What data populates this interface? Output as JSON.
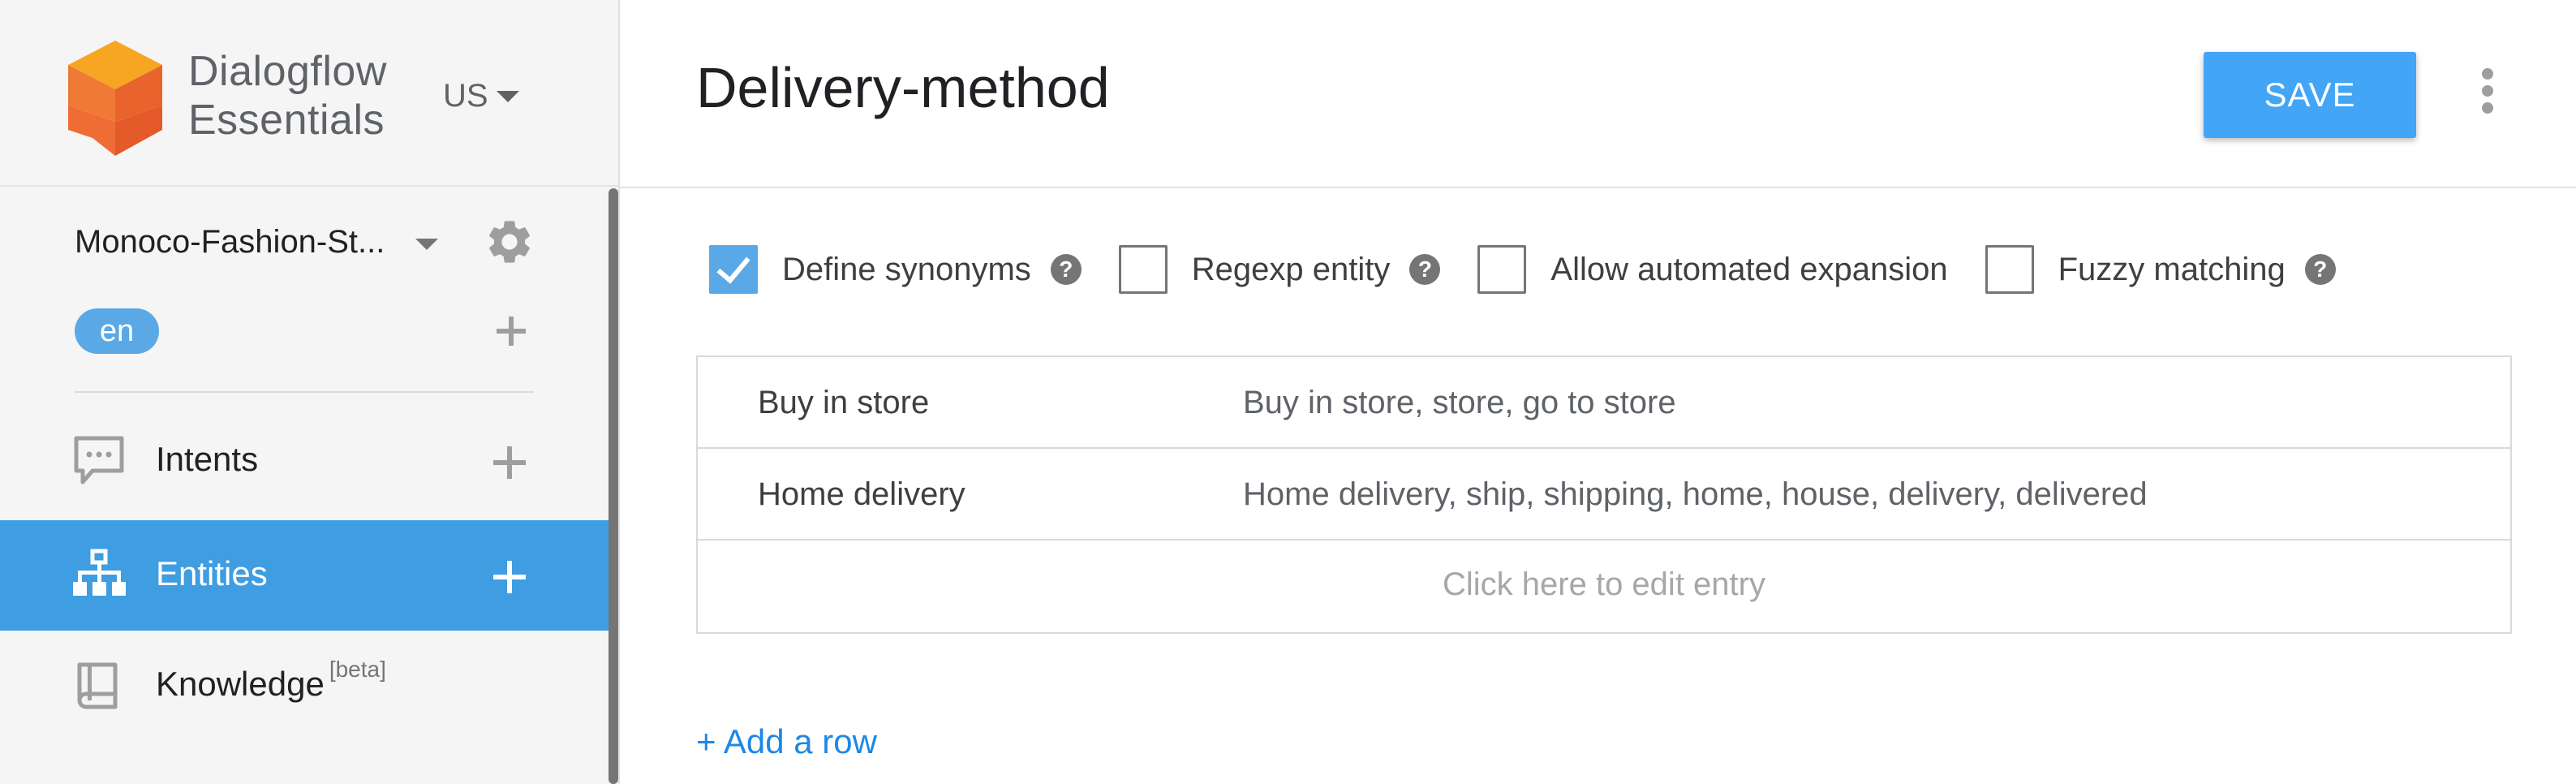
{
  "brand": {
    "line1": "Dialogflow",
    "line2": "Essentials",
    "region": "US"
  },
  "agent": {
    "name": "Monoco-Fashion-St...",
    "language": "en"
  },
  "nav": {
    "intents": "Intents",
    "entities": "Entities",
    "knowledge": "Knowledge",
    "knowledge_badge": "[beta]"
  },
  "header": {
    "title": "Delivery-method",
    "save_label": "SAVE"
  },
  "options": [
    {
      "label": "Define synonyms",
      "checked": true,
      "help": true
    },
    {
      "label": "Regexp entity",
      "checked": false,
      "help": true
    },
    {
      "label": "Allow automated expansion",
      "checked": false,
      "help": false
    },
    {
      "label": "Fuzzy matching",
      "checked": false,
      "help": true
    }
  ],
  "entries": [
    {
      "reference": "Buy in store",
      "synonyms": "Buy in store, store, go to store"
    },
    {
      "reference": "Home delivery",
      "synonyms": "Home delivery, ship, shipping, home, house, delivery, delivered"
    }
  ],
  "entry_placeholder": "Click here to edit entry",
  "add_row_label": "+ Add a row",
  "colors": {
    "accent": "#42a5f5",
    "active_nav": "#3f9de1",
    "chip": "#5aa9e6",
    "link": "#1e88e5",
    "logo_orange": "#ef6c35",
    "logo_yellow": "#f6a623"
  },
  "icons": {
    "logo": "dialogflow-cube-icon",
    "settings": "gear-icon",
    "intents": "chat-bubble-icon",
    "entities": "hierarchy-icon",
    "knowledge": "book-icon"
  }
}
